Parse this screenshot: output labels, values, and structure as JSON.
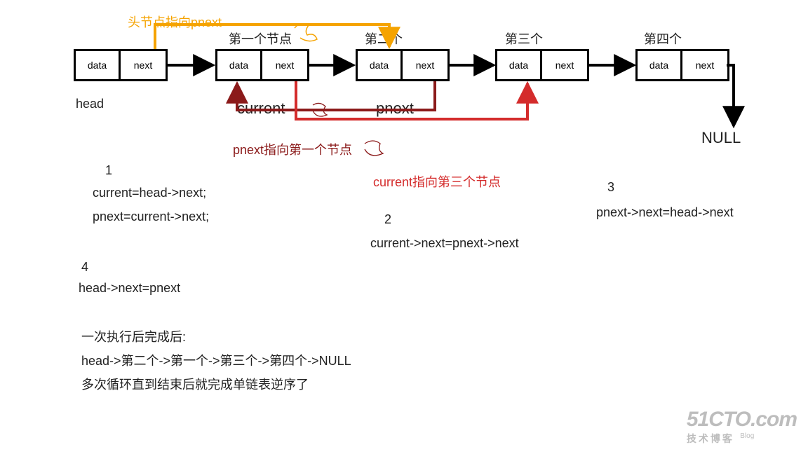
{
  "nodes": {
    "head": {
      "data": "data",
      "next": "next",
      "caption_above": "",
      "caption_below": "head"
    },
    "n1": {
      "data": "data",
      "next": "next",
      "caption_above": "第一个节点",
      "caption_below": "current"
    },
    "n2": {
      "data": "data",
      "next": "next",
      "caption_above": "第二个",
      "caption_below": "pnext"
    },
    "n3": {
      "data": "data",
      "next": "next",
      "caption_above": "第三个",
      "caption_below": ""
    },
    "n4": {
      "data": "data",
      "next": "next",
      "caption_above": "第四个",
      "caption_below": ""
    }
  },
  "terminal": "NULL",
  "annotations": {
    "orange_top": "头节点指向pnext",
    "pnext_arrow_label": "pnext指向第一个节点",
    "current_arrow_label": "current指向第三个节点"
  },
  "steps": {
    "s1_num": "1",
    "s1a": "current=head->next;",
    "s1b": "pnext=current->next;",
    "s2_num": "2",
    "s2": "current->next=pnext->next",
    "s3_num": "3",
    "s3": "pnext->next=head->next",
    "s4_num": "4",
    "s4": "head->next=pnext"
  },
  "summary": {
    "l1": "一次执行后完成后:",
    "l2": "head->第二个->第一个->第三个->第四个->NULL",
    "l3": "多次循环直到结束后就完成单链表逆序了"
  },
  "watermark": {
    "brand": "51CTO.com",
    "sub": "技术博客",
    "blog": "Blog"
  }
}
